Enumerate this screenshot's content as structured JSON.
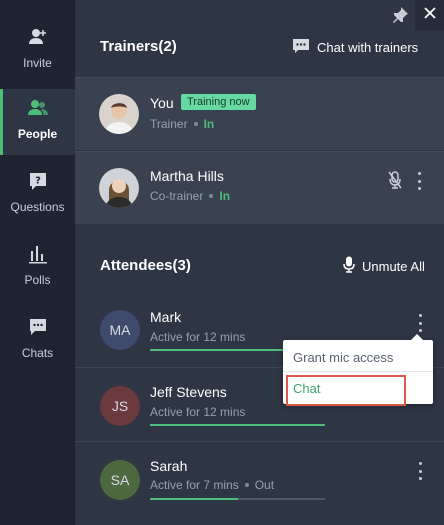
{
  "rail": {
    "items": [
      {
        "label": "Invite",
        "icon": "add-user-icon"
      },
      {
        "label": "People",
        "icon": "people-icon",
        "active": true
      },
      {
        "label": "Questions",
        "icon": "question-icon"
      },
      {
        "label": "Polls",
        "icon": "poll-icon"
      },
      {
        "label": "Chats",
        "icon": "chat-bubble-icon"
      }
    ]
  },
  "header": {
    "pin_icon": "pin-icon",
    "close_icon": "close-icon"
  },
  "trainers": {
    "title": "Trainers(2)",
    "action_label": "Chat with trainers",
    "rows": [
      {
        "name": "You",
        "badge": "Training now",
        "role": "Trainer",
        "status": "In"
      },
      {
        "name": "Martha Hills",
        "role": "Co-trainer",
        "status": "In",
        "mic": "muted"
      }
    ]
  },
  "attendees": {
    "title": "Attendees(3)",
    "action_label": "Unmute All",
    "rows": [
      {
        "initials": "MA",
        "name": "Mark",
        "activity": "Active for 12 mins",
        "status": "",
        "progress": 0.8,
        "avatar_color": "#3f4b6b"
      },
      {
        "initials": "JS",
        "name": "Jeff Stevens",
        "activity": "Active for 12 mins",
        "status": "",
        "progress": 1.0,
        "avatar_color": "#6b3a3e"
      },
      {
        "initials": "SA",
        "name": "Sarah",
        "activity": "Active for 7 mins",
        "status": "Out",
        "progress": 0.5,
        "avatar_color": "#4d6a3f"
      }
    ]
  },
  "menu": {
    "items": [
      "Grant mic access",
      "Chat"
    ]
  },
  "colors": {
    "accent": "#4fbd7a",
    "badge": "#66d9a3",
    "highlight": "#d9594c"
  }
}
